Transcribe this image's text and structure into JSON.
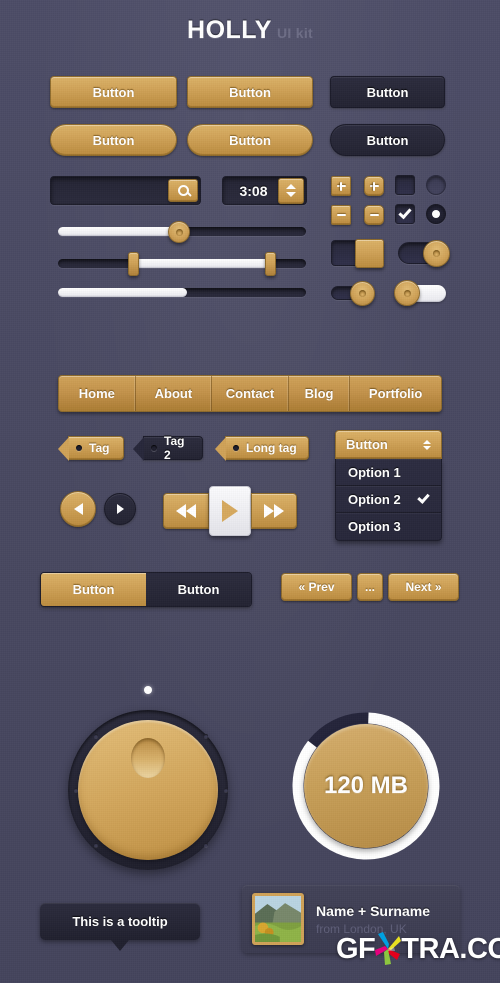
{
  "header": {
    "title": "HOLLY",
    "subtitle": "UI kit"
  },
  "buttons": {
    "gold_rect_1": "Button",
    "gold_rect_2": "Button",
    "dark_rect": "Button",
    "gold_round_1": "Button",
    "gold_round_2": "Button",
    "dark_round": "Button"
  },
  "search": {
    "value": "",
    "placeholder": "",
    "icon": "search-icon"
  },
  "stepper": {
    "value": "3:08",
    "up_icon": "triangle-up-icon",
    "down_icon": "triangle-down-icon"
  },
  "small_buttons": {
    "plus_square": "+",
    "plus_rounded": "+",
    "minus_square": "−",
    "minus_rounded": "−"
  },
  "checkbox": {
    "unchecked_state": "off",
    "checked_state": "on",
    "check_icon": "check-icon"
  },
  "radio": {
    "unchecked_state": "off",
    "checked_state": "on"
  },
  "sliders": [
    {
      "name": "slider-round-handle",
      "value_pct": 53,
      "fill": "left",
      "handle": "round"
    },
    {
      "name": "slider-range",
      "value_start_pct": 30,
      "value_end_pct": 88,
      "handle": "vertical-bar"
    },
    {
      "name": "progress-bar",
      "value_pct": 52,
      "fill": "left",
      "handle": "none"
    }
  ],
  "toggles": [
    {
      "name": "toggle-square-knob",
      "state": "on"
    },
    {
      "name": "toggle-pill-knob",
      "state": "on"
    },
    {
      "name": "toggle-small-knob",
      "state": "on"
    },
    {
      "name": "toggle-white-track",
      "state": "off"
    }
  ],
  "nav": {
    "items": [
      "Home",
      "About",
      "Contact",
      "Blog",
      "Portfolio"
    ]
  },
  "tags": [
    {
      "label": "Tag",
      "style": "gold"
    },
    {
      "label": "Tag 2",
      "style": "dark"
    },
    {
      "label": "Long tag",
      "style": "gold"
    }
  ],
  "dropdown": {
    "label": "Button",
    "options": [
      "Option 1",
      "Option 2",
      "Option 3"
    ],
    "selected": "Option 2",
    "arrows_icon": "up-down-arrows-icon",
    "check_icon": "check-icon"
  },
  "media": {
    "prev_icon": "triangle-left-icon",
    "next_icon": "triangle-right-icon",
    "rewind_icon": "rewind-icon",
    "play_icon": "play-icon",
    "forward_icon": "fast-forward-icon"
  },
  "segmented": {
    "items": [
      "Button",
      "Button"
    ],
    "active_index": 0
  },
  "pagination": {
    "prev": "« Prev",
    "ellipsis": "...",
    "next": "Next »"
  },
  "knob": {
    "name": "rotary-knob",
    "indicator": "top",
    "dot_count": 8
  },
  "progress_circle": {
    "label": "120 MB",
    "value_pct": 85
  },
  "tooltip": {
    "text": "This is a tooltip"
  },
  "profile_card": {
    "name": "Name + Surname",
    "location": "from London, UK",
    "avatar": "landscape-photo"
  },
  "watermark": {
    "text_before": "GF",
    "text_x": "X",
    "text_after": "TRA.COM"
  },
  "colors": {
    "background": "#4a4a63",
    "gold_light": "#dcb267",
    "gold": "#cfa257",
    "gold_dark": "#bb8c3f",
    "dark_panel": "#2b2b3d",
    "white": "#ffffff",
    "muted_text": "#5e5e78"
  }
}
